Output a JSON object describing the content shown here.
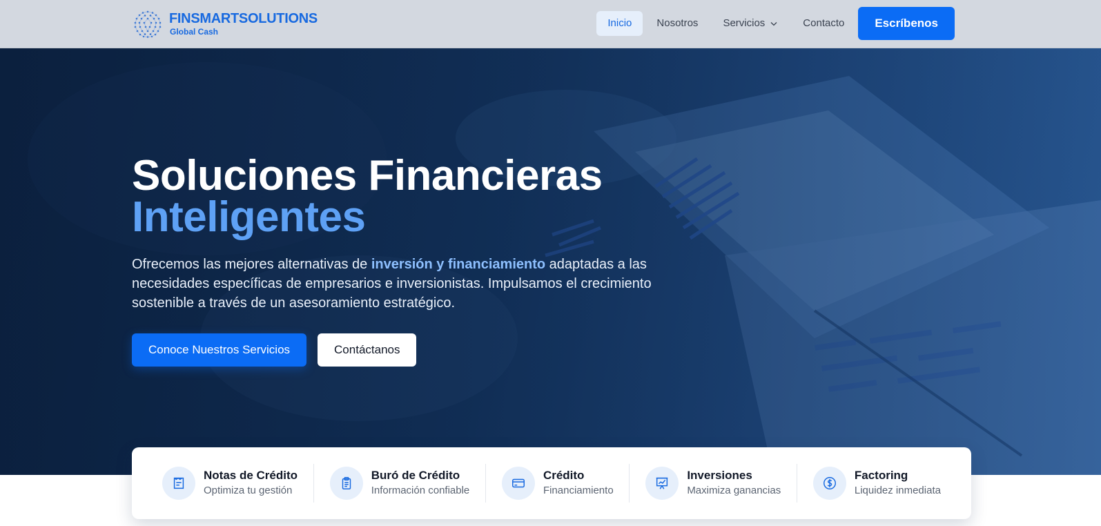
{
  "brand": {
    "name": "FINSMARTSOLUTIONS",
    "tagline": "Global Cash",
    "logo_icon": "globe-dots-logo"
  },
  "nav": {
    "items": [
      {
        "label": "Inicio",
        "active": true
      },
      {
        "label": "Nosotros",
        "active": false
      },
      {
        "label": "Servicios",
        "active": false,
        "icon": "chevron-down-icon"
      },
      {
        "label": "Contacto",
        "active": false
      }
    ],
    "cta_label": "Escríbenos"
  },
  "hero": {
    "title": "Soluciones Financieras",
    "title_accent": "Inteligentes",
    "desc_before": "Ofrecemos las mejores alternativas de ",
    "desc_highlight": "inversión y financiamiento",
    "desc_after": " adaptadas a las necesidades específicas de empresarios e inversionistas. Impulsamos el crecimiento sostenible a través de un asesoramiento estratégico.",
    "primary_button": "Conoce Nuestros Servicios",
    "secondary_button": "Contáctanos"
  },
  "services": [
    {
      "title": "Notas de Crédito",
      "subtitle": "Optimiza tu gestión",
      "icon": "receipt-icon"
    },
    {
      "title": "Buró de Crédito",
      "subtitle": "Información confiable",
      "icon": "clipboard-icon"
    },
    {
      "title": "Crédito",
      "subtitle": "Financiamiento",
      "icon": "credit-card-icon"
    },
    {
      "title": "Inversiones",
      "subtitle": "Maximiza ganancias",
      "icon": "presentation-chart-icon"
    },
    {
      "title": "Factoring",
      "subtitle": "Liquidez inmediata",
      "icon": "dollar-circle-icon"
    }
  ],
  "colors": {
    "accent": "#0b6cf5",
    "brand": "#1769e0",
    "hero_accent": "#5ea1f5",
    "highlight": "#8ec0ff"
  }
}
